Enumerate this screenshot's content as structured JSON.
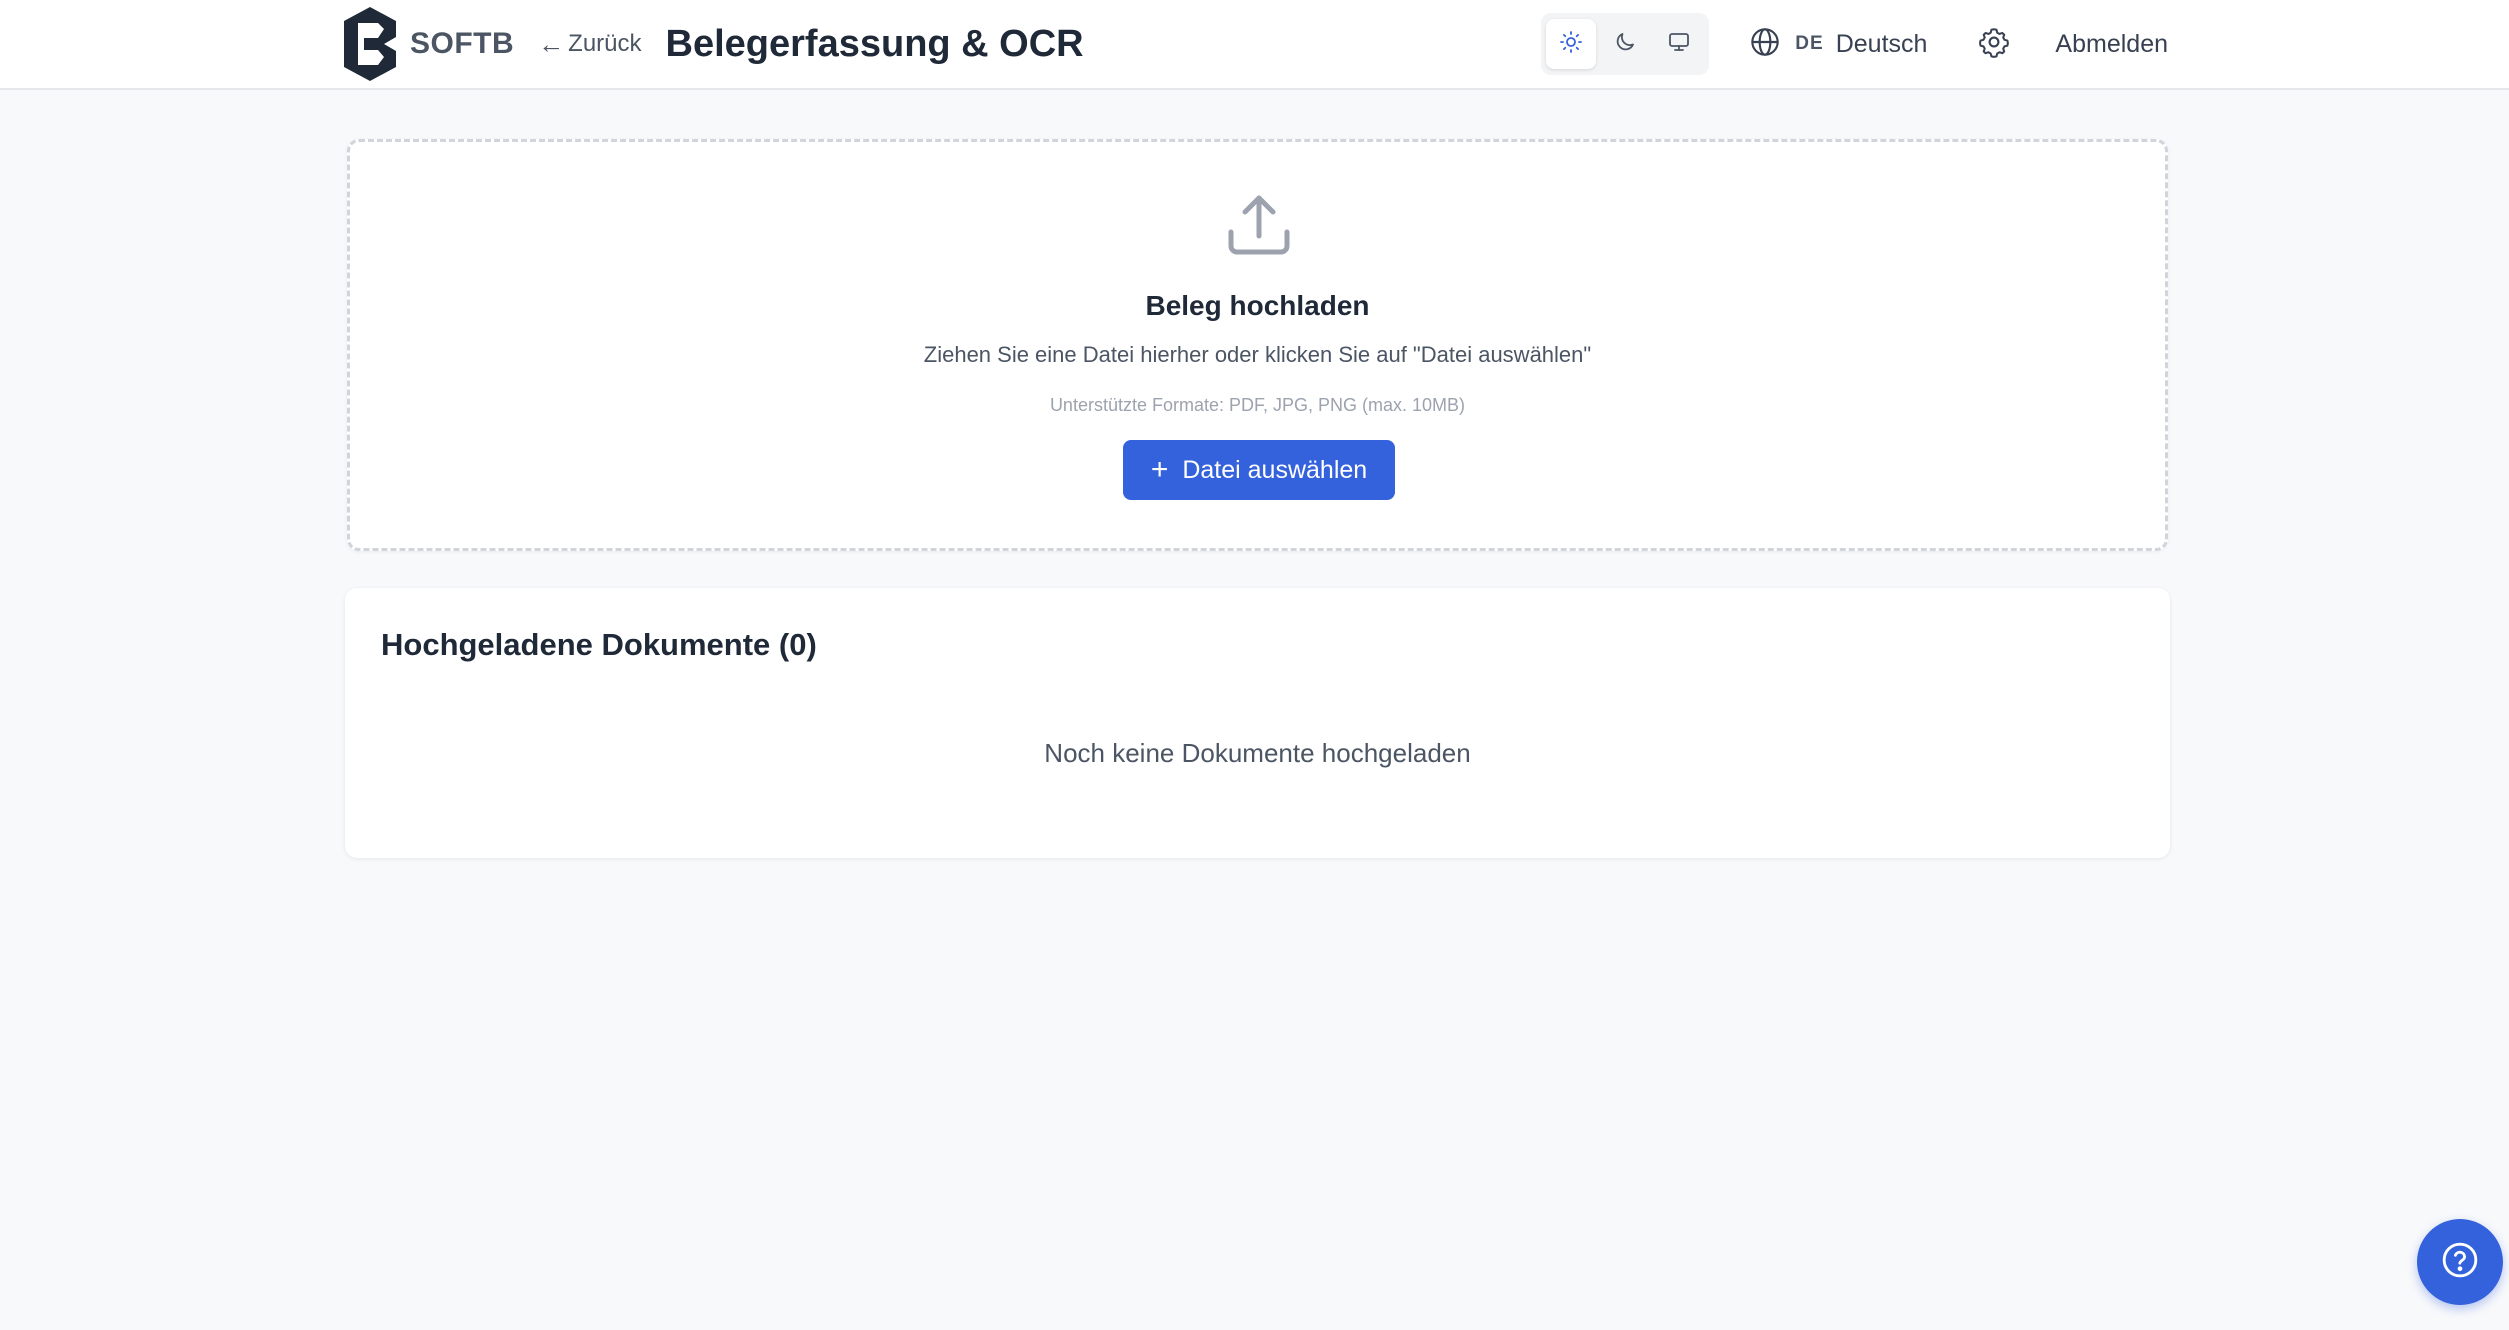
{
  "header": {
    "logo_text": "SOFTB",
    "back_label": "Zurück",
    "title": "Belegerfassung & OCR",
    "theme_options": [
      "sun-icon",
      "moon-icon",
      "monitor-icon"
    ],
    "active_theme": "sun-icon",
    "language_code": "DE",
    "language_name": "Deutsch",
    "logout_label": "Abmelden"
  },
  "upload": {
    "title": "Beleg hochladen",
    "hint": "Ziehen Sie eine Datei hierher oder klicken Sie auf \"Datei auswählen\"",
    "formats": "Unterstützte Formate: PDF, JPG, PNG (max. 10MB)",
    "button_label": "Datei auswählen"
  },
  "documents": {
    "title": "Hochgeladene Dokumente (0)",
    "empty_text": "Noch keine Dokumente hochgeladen"
  },
  "colors": {
    "accent": "#3461dc",
    "background": "#f8f9fb"
  }
}
